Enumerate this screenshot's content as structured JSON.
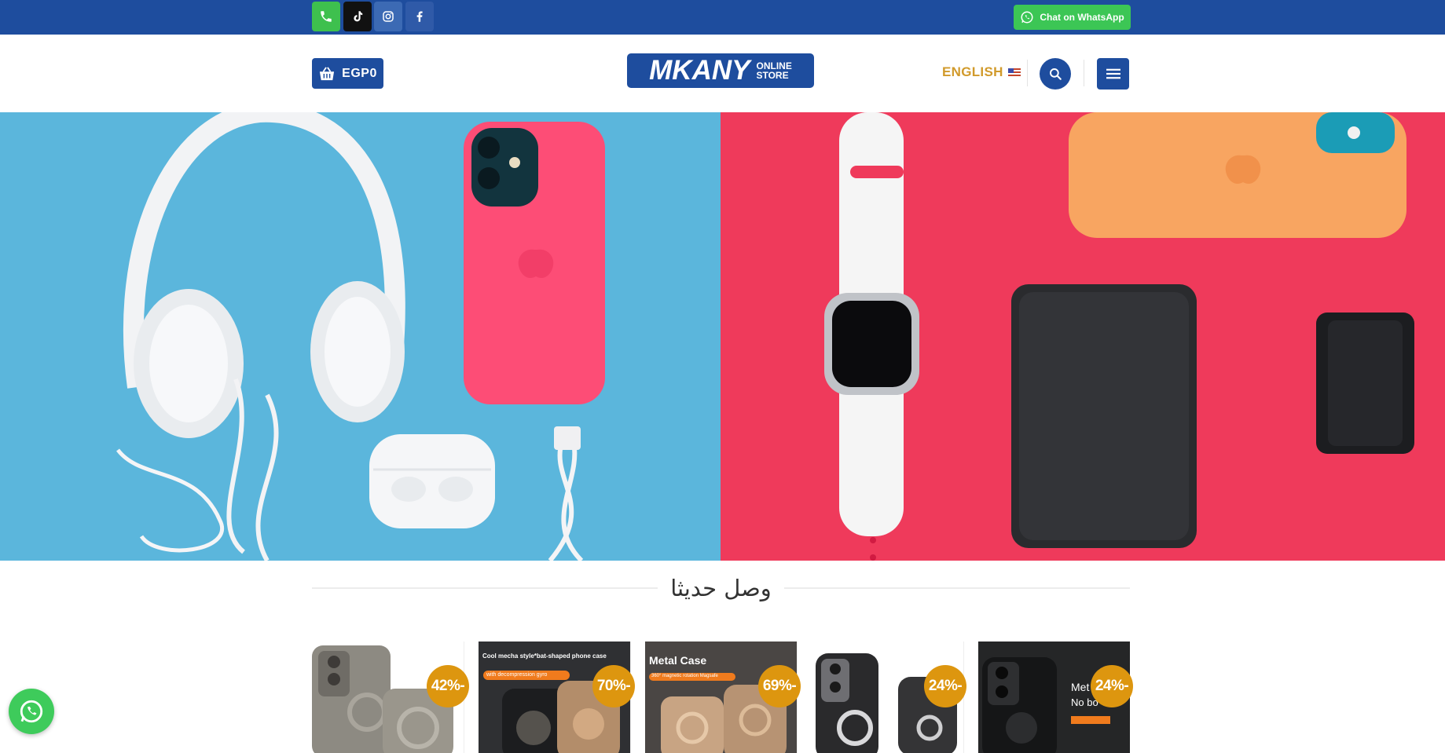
{
  "topbar": {
    "social": [
      {
        "name": "phone-icon",
        "bg": "#3ec04e"
      },
      {
        "name": "tiktok-icon",
        "bg": "#111111"
      },
      {
        "name": "instagram-icon",
        "bg": "#3c6ab4"
      },
      {
        "name": "facebook-icon",
        "bg": "#2f5aa8"
      }
    ],
    "whatsapp_label": "Chat on WhatsApp"
  },
  "header": {
    "cart_label": "EGP0",
    "logo_main": "MKANY",
    "logo_line1": "ONLINE",
    "logo_line2": "STORE",
    "language_label": "ENGLISH"
  },
  "hero": {
    "slide_count": 2,
    "left_bg": "#5bb6dc",
    "right_bg": "#ef3a5b"
  },
  "section": {
    "title": "وصل حديثا"
  },
  "products": [
    {
      "discount": "42%-",
      "text": ""
    },
    {
      "discount": "70%-",
      "text": "Cool mecha style*bat-shaped phone case",
      "sub": "with decompression gyro"
    },
    {
      "discount": "69%-",
      "text": "Metal Case",
      "sub": "360° magnetic rotation Magsafe"
    },
    {
      "discount": "24%-",
      "text": ""
    },
    {
      "discount": "24%-",
      "text": "Met",
      "sub": "No bo"
    }
  ],
  "colors": {
    "brand_blue": "#1e4d9e",
    "accent_gold": "#d19a2b",
    "badge": "#dd960f",
    "whatsapp": "#3cc655"
  }
}
